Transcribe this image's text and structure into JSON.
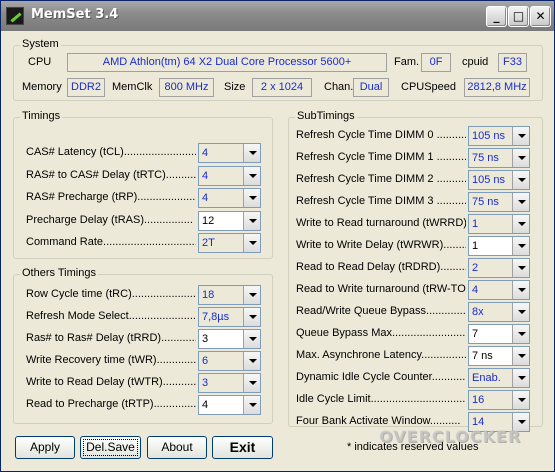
{
  "window": {
    "title": "MemSet 3.4",
    "icon": "memset-app-icon",
    "controls": {
      "minimize": "_",
      "maximize": "□",
      "close": "✕"
    }
  },
  "system": {
    "legend": "System",
    "cpu_label": "CPU",
    "cpu_value": "AMD Athlon(tm) 64 X2 Dual Core Processor 5600+",
    "fam_label": "Fam.",
    "fam_value": "0F",
    "cpuid_label": "cpuid",
    "cpuid_value": "F33",
    "memory_label": "Memory",
    "memory_value": "DDR2",
    "memclk_label": "MemClk",
    "memclk_value": "800 MHz",
    "size_label": "Size",
    "size_value": "2 x 1024",
    "chan_label": "Chan.",
    "chan_value": "Dual",
    "cpuspeed_label": "CPUSpeed",
    "cpuspeed_value": "2812,8 MHz"
  },
  "timings": {
    "legend": "Timings",
    "rows": [
      {
        "label": "CAS# Latency (tCL)..............................",
        "value": "4"
      },
      {
        "label": "RAS# to CAS# Delay (tRTC)..........",
        "value": "4"
      },
      {
        "label": "RAS# Precharge (tRP).....................",
        "value": "4"
      },
      {
        "label": "Precharge Delay  (tRAS)................",
        "value": "12"
      },
      {
        "label": "Command Rate...................................",
        "value": "2T"
      }
    ]
  },
  "others": {
    "legend": "Others Timings",
    "rows": [
      {
        "label": "Row Cycle time (tRC)......................",
        "value": "18"
      },
      {
        "label": "Refresh Mode Select.........................",
        "value": "7,8µs"
      },
      {
        "label": "Ras# to Ras# Delay (tRRD)..............",
        "value": "3"
      },
      {
        "label": "Write Recovery time (tWR)...............",
        "value": "6"
      },
      {
        "label": "Write to Read Delay (tWTR)..............",
        "value": "3"
      },
      {
        "label": "Read to Precharge (tRTP)...............",
        "value": "4"
      }
    ]
  },
  "subtimings": {
    "legend": "SubTimings",
    "rows": [
      {
        "label": "Refresh Cycle Time  DIMM 0 ..........",
        "value": "105 ns"
      },
      {
        "label": "Refresh Cycle Time  DIMM 1 ..........",
        "value": "75 ns"
      },
      {
        "label": "Refresh Cycle Time  DIMM 2 ..........",
        "value": "105 ns"
      },
      {
        "label": "Refresh Cycle Time  DIMM 3 ..........",
        "value": "75 ns"
      },
      {
        "label": "Write to Read turnaround (tWRRD)....",
        "value": "1"
      },
      {
        "label": "Write to Write Delay (tWRWR)..........",
        "value": "1"
      },
      {
        "label": "Read to Read Delay (tRDRD)............",
        "value": "2"
      },
      {
        "label": "Read to Write turnaround (tRW-TO).......",
        "value": "4"
      },
      {
        "label": "Read/Write Queue Bypass...............",
        "value": "8x"
      },
      {
        "label": "Queue Bypass Max..............................",
        "value": "7"
      },
      {
        "label": "Max. Asynchrone Latency..................",
        "value": "7 ns"
      },
      {
        "label": "Dynamic Idle Cycle Counter............",
        "value": "Enab."
      },
      {
        "label": "Idle Cycle Limit.................................",
        "value": "16"
      },
      {
        "label": "Four Bank Activate Window..........",
        "value": "14"
      }
    ]
  },
  "buttons": {
    "apply": "Apply",
    "delsave": "Del.Save",
    "about": "About",
    "exit": "Exit"
  },
  "note": "* indicates reserved values",
  "watermark": "OVERCLOCKER"
}
